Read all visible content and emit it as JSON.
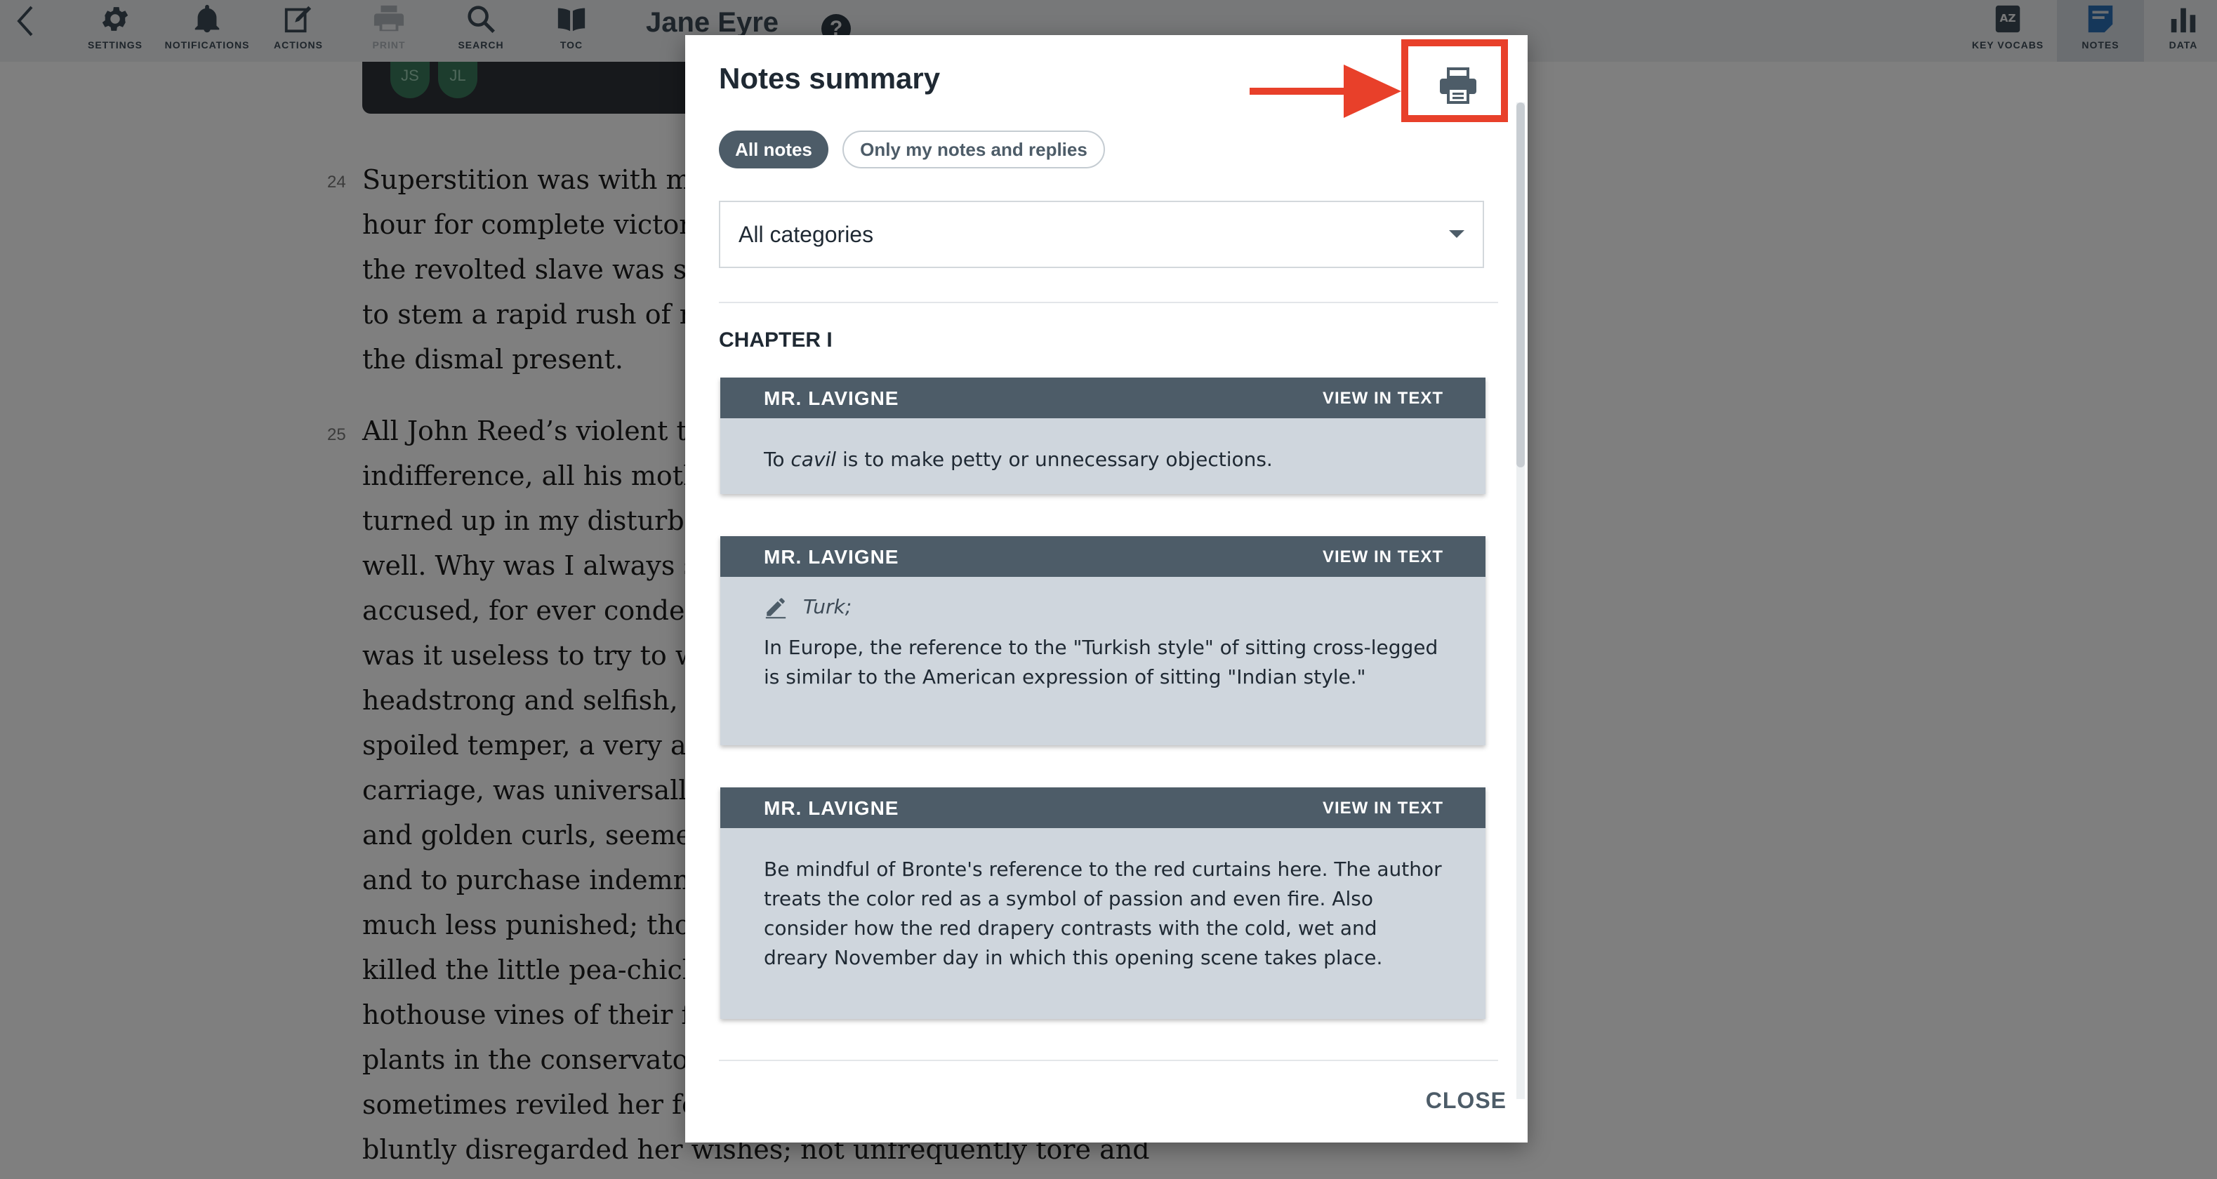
{
  "topbar": {
    "left_items": [
      {
        "label": "SETTINGS",
        "icon": "gear-icon"
      },
      {
        "label": "NOTIFICATIONS",
        "icon": "bell-icon"
      },
      {
        "label": "ACTIONS",
        "icon": "edit-icon"
      },
      {
        "label": "PRINT",
        "icon": "printer-icon",
        "disabled": true
      },
      {
        "label": "SEARCH",
        "icon": "search-icon"
      },
      {
        "label": "TOC",
        "icon": "book-icon"
      }
    ],
    "book_title": "Jane Eyre",
    "help_label": "?",
    "right_items": [
      {
        "label": "KEY VOCABS",
        "icon": "az-book-icon"
      },
      {
        "label": "NOTES",
        "icon": "notes-icon",
        "active": true
      },
      {
        "label": "DATA",
        "icon": "bar-chart-icon"
      }
    ]
  },
  "reading": {
    "avatars": [
      "JS",
      "JL"
    ],
    "paragraph_24": {
      "number": "24",
      "lines": [
        "Superstition was with me at that moment; but it was not yet her",
        "hour for complete victory: my blood was still warm; the mood of",
        "the revolted slave was still bracing me with its bitter vigour; I had",
        "to stem a rapid rush of retrospective thought before I quailed to",
        "the dismal present."
      ]
    },
    "paragraph_25": {
      "number": "25",
      "lines": [
        "All John Reed’s violent tyrannies, all his sisters’ proud",
        "indifference, all his mother’s aversion, all the servants’ partiality,",
        "turned up in my disturbed mind like a dark deposit in a turbid",
        "well.  Why was I always suffering, always browbeaten, always",
        "accused, for ever condemned?  Why could I never please?  Why",
        "was it useless to try to win any one’s favour?  Eliza, who was",
        "headstrong and selfish, was respected.  Georgiana, who had a",
        "spoiled temper, a very acrid spite, a captious and insolent",
        "carriage, was universally indulged.  Her beauty, her pink cheeks",
        "and golden curls, seemed to give delight to all who looked at her,",
        "and to purchase indemnity for every fault.  John no one thwarted,",
        "much less punished; though he twisted the necks of the pigeons,",
        "killed the little pea-chicks, set the dogs at the sheep, stripped the",
        "hothouse vines of their fruit, and broke the buds off the choicest",
        "plants in the conservatory: he called his mother “old girl,” too;",
        "sometimes reviled her for her dark skin, similar to his own;",
        "bluntly disregarded her wishes; not unfrequently tore and"
      ]
    }
  },
  "modal": {
    "title": "Notes summary",
    "print_icon": "printer-icon",
    "filters": {
      "all_notes": "All notes",
      "my_notes": "Only my notes and replies"
    },
    "category_select": {
      "value": "All categories"
    },
    "chapter_heading": "CHAPTER I",
    "notes": [
      {
        "author": "MR. LAVIGNE",
        "view_label": "VIEW IN TEXT",
        "text_before": "To ",
        "text_em": "cavil",
        "text_after": " is to make petty or unnecessary objections."
      },
      {
        "author": "MR. LAVIGNE",
        "view_label": "VIEW IN TEXT",
        "quote": "Turk;",
        "text": "In Europe, the reference to the \"Turkish style\" of sitting cross-legged is similar to the American expression of sitting \"Indian style.\""
      },
      {
        "author": "MR. LAVIGNE",
        "view_label": "VIEW IN TEXT",
        "text": "Be mindful of Bronte's reference to the red curtains here. The author treats the color red as a symbol of passion and even fire. Also consider how the red drapery contrasts with the cold, wet and dreary November day in which this opening scene takes place."
      }
    ],
    "close_label": "CLOSE"
  },
  "colors": {
    "highlight": "#e8402a",
    "note_header": "#4d5c68",
    "note_body": "#cfd6dd",
    "active_pill": "#4d5c68"
  }
}
